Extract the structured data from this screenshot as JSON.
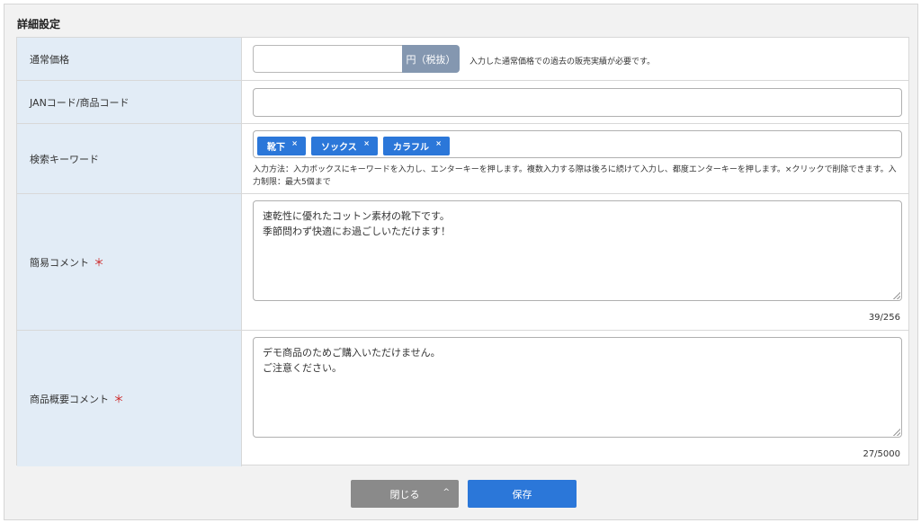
{
  "section_title": "詳細設定",
  "fields": {
    "price": {
      "label": "通常価格",
      "value": "",
      "unit": "円（税抜）",
      "note": "入力した通常価格での過去の販売実績が必要です。"
    },
    "jan": {
      "label": "JANコード/商品コード",
      "value": ""
    },
    "keywords": {
      "label": "検索キーワード",
      "tags": [
        "靴下",
        "ソックス",
        "カラフル"
      ],
      "remove_glyph": "×",
      "help": "入力方法：入力ボックスにキーワードを入力し、エンターキーを押します。複数入力する際は後ろに続けて入力し、都度エンターキーを押します。×クリックで削除できます。入力制限：最大5個まで"
    },
    "short_comment": {
      "label": "簡易コメント",
      "required_mark": "＊",
      "line1": "速乾性に優れたコットン素材の靴下です。",
      "line2": "季節問わず快適にお過ごしいただけます！",
      "counter": "39/256"
    },
    "summary_comment": {
      "label": "商品概要コメント",
      "required_mark": "＊",
      "line1": "デモ商品のためご購入いただけません。",
      "line2": "ご注意ください。",
      "counter": "27/5000"
    }
  },
  "buttons": {
    "close_label": "閉じる",
    "close_chevron": "^",
    "save_label": "保存"
  },
  "colors": {
    "label_bg": "#e2ecf6",
    "accent": "#2b77d9",
    "unit_bg": "#8497b0",
    "required": "#cc2222",
    "close_bg": "#8a8a8a"
  }
}
